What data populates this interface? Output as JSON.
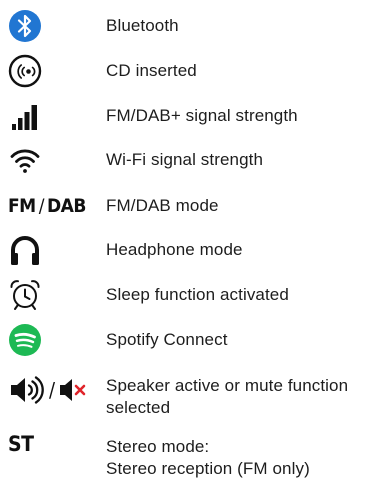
{
  "colors": {
    "bluetooth_blue": "#2176d2",
    "spotify_green": "#1db954",
    "mute_red": "#e0242a",
    "icon_black": "#111111"
  },
  "items": [
    {
      "icon": "bluetooth-icon",
      "label": "Bluetooth"
    },
    {
      "icon": "cd-icon",
      "label": "CD inserted"
    },
    {
      "icon": "signal-strength-icon",
      "label": "FM/DAB+ signal strength"
    },
    {
      "icon": "wifi-icon",
      "label": "Wi-Fi signal strength"
    },
    {
      "icon": "fm-dab-mode-icon",
      "icon_text": {
        "fm": "FM",
        "slash": "/",
        "dab": "DAB"
      },
      "label": "FM/DAB mode"
    },
    {
      "icon": "headphones-icon",
      "label": "Headphone mode"
    },
    {
      "icon": "alarm-clock-icon",
      "label": "Sleep function activated"
    },
    {
      "icon": "spotify-icon",
      "label": "Spotify Connect"
    },
    {
      "icon": "speaker-mute-icon",
      "icon_text": {
        "slash": "/"
      },
      "label_lines": [
        "Speaker active or mute function",
        "selected"
      ]
    },
    {
      "icon": "stereo-icon",
      "icon_text": {
        "st": "ST"
      },
      "label_lines": [
        "Stereo mode:",
        "Stereo reception (FM only)"
      ]
    }
  ]
}
